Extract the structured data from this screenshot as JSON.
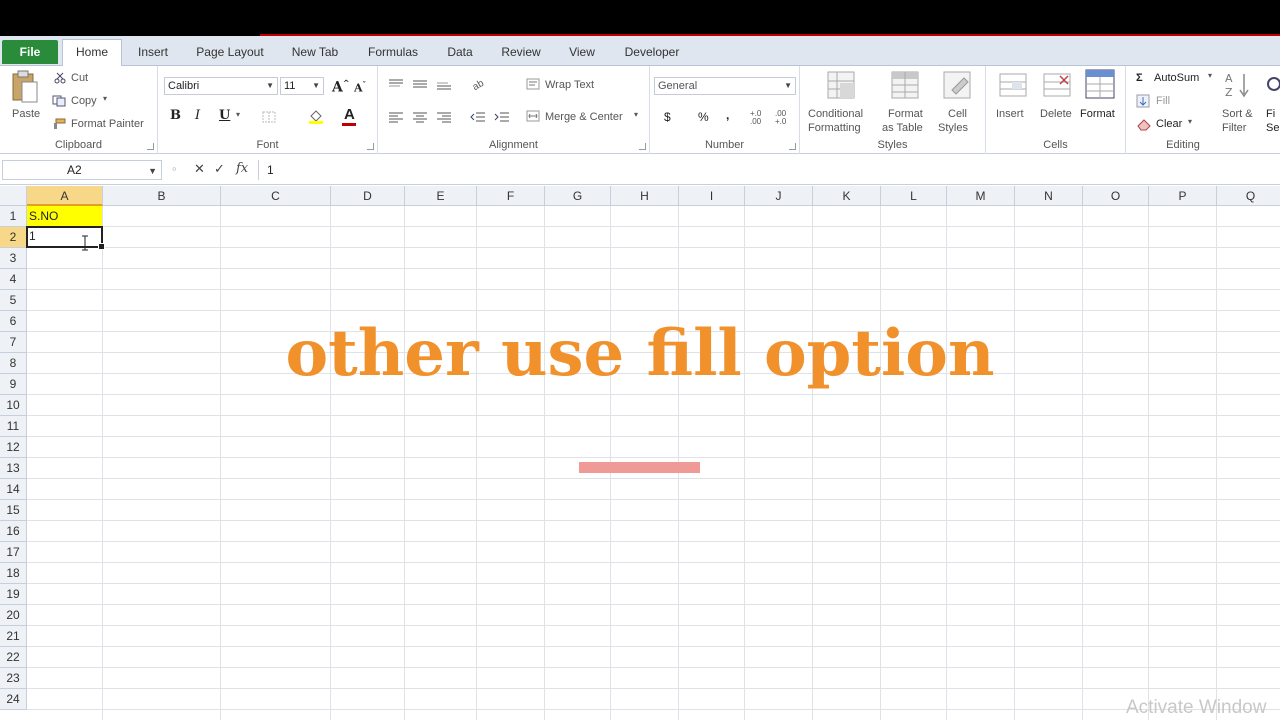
{
  "tabs": {
    "file": "File",
    "items": [
      "Home",
      "Insert",
      "Page Layout",
      "New Tab",
      "Formulas",
      "Data",
      "Review",
      "View",
      "Developer"
    ]
  },
  "ribbon": {
    "clipboard": {
      "paste": "Paste",
      "cut": "Cut",
      "copy": "Copy",
      "format_painter": "Format Painter",
      "label": "Clipboard"
    },
    "font": {
      "name": "Calibri",
      "size": "11",
      "bold": "B",
      "italic": "I",
      "underline": "U",
      "label": "Font"
    },
    "alignment": {
      "wrap_text": "Wrap Text",
      "merge_center": "Merge & Center",
      "label": "Alignment"
    },
    "number": {
      "format": "General",
      "currency": "$",
      "percent": "%",
      "comma": ",",
      "inc_dec": "+.0 .00",
      "dec_dec": ".00 +.0",
      "label": "Number"
    },
    "styles": {
      "conditional_1": "Conditional",
      "conditional_2": "Formatting",
      "table_1": "Format",
      "table_2": "as Table",
      "cell_1": "Cell",
      "cell_2": "Styles",
      "label": "Styles"
    },
    "cells": {
      "insert": "Insert",
      "delete": "Delete",
      "format": "Format",
      "label": "Cells"
    },
    "editing": {
      "autosum": "AutoSum",
      "fill": "Fill",
      "clear": "Clear",
      "sort_1": "Sort &",
      "sort_2": "Filter",
      "find_1": "Fi",
      "find_2": "Se",
      "label": "Editing"
    }
  },
  "formula_bar": {
    "name_box": "A2",
    "fx": "fx",
    "value": "1"
  },
  "grid": {
    "columns": [
      "A",
      "B",
      "C",
      "D",
      "E",
      "F",
      "G",
      "H",
      "I",
      "J",
      "K",
      "L",
      "M",
      "N",
      "O",
      "P",
      "Q"
    ],
    "rows": [
      "1",
      "2",
      "3",
      "4",
      "5",
      "6",
      "7",
      "8",
      "9",
      "10",
      "11",
      "12",
      "13",
      "14",
      "15",
      "16",
      "17",
      "18",
      "19",
      "20",
      "21",
      "22",
      "23",
      "24"
    ],
    "a1": "S.NO",
    "a2": "1"
  },
  "overlay": {
    "title": "other use fill option"
  },
  "watermark": "Activate Window",
  "colors": {
    "file_tab": "#2a8c3a",
    "header_select": "#f7d889",
    "cell_highlight": "#ffff00",
    "overlay_text": "#f0912c",
    "overlay_bar": "#f09a98"
  }
}
